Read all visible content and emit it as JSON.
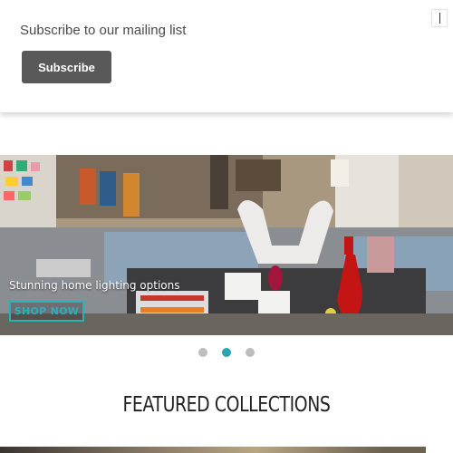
{
  "popup": {
    "title": "Subscribe to our mailing list",
    "button_label": "Subscribe"
  },
  "hero": {
    "caption": "Stunning home lighting options",
    "cta_label": "SHOP NOW",
    "accent_color": "#2ab0b9"
  },
  "carousel": {
    "slide_count": 3,
    "active_slide": 2
  },
  "featured": {
    "title": "FEATURED COLLECTIONS"
  }
}
